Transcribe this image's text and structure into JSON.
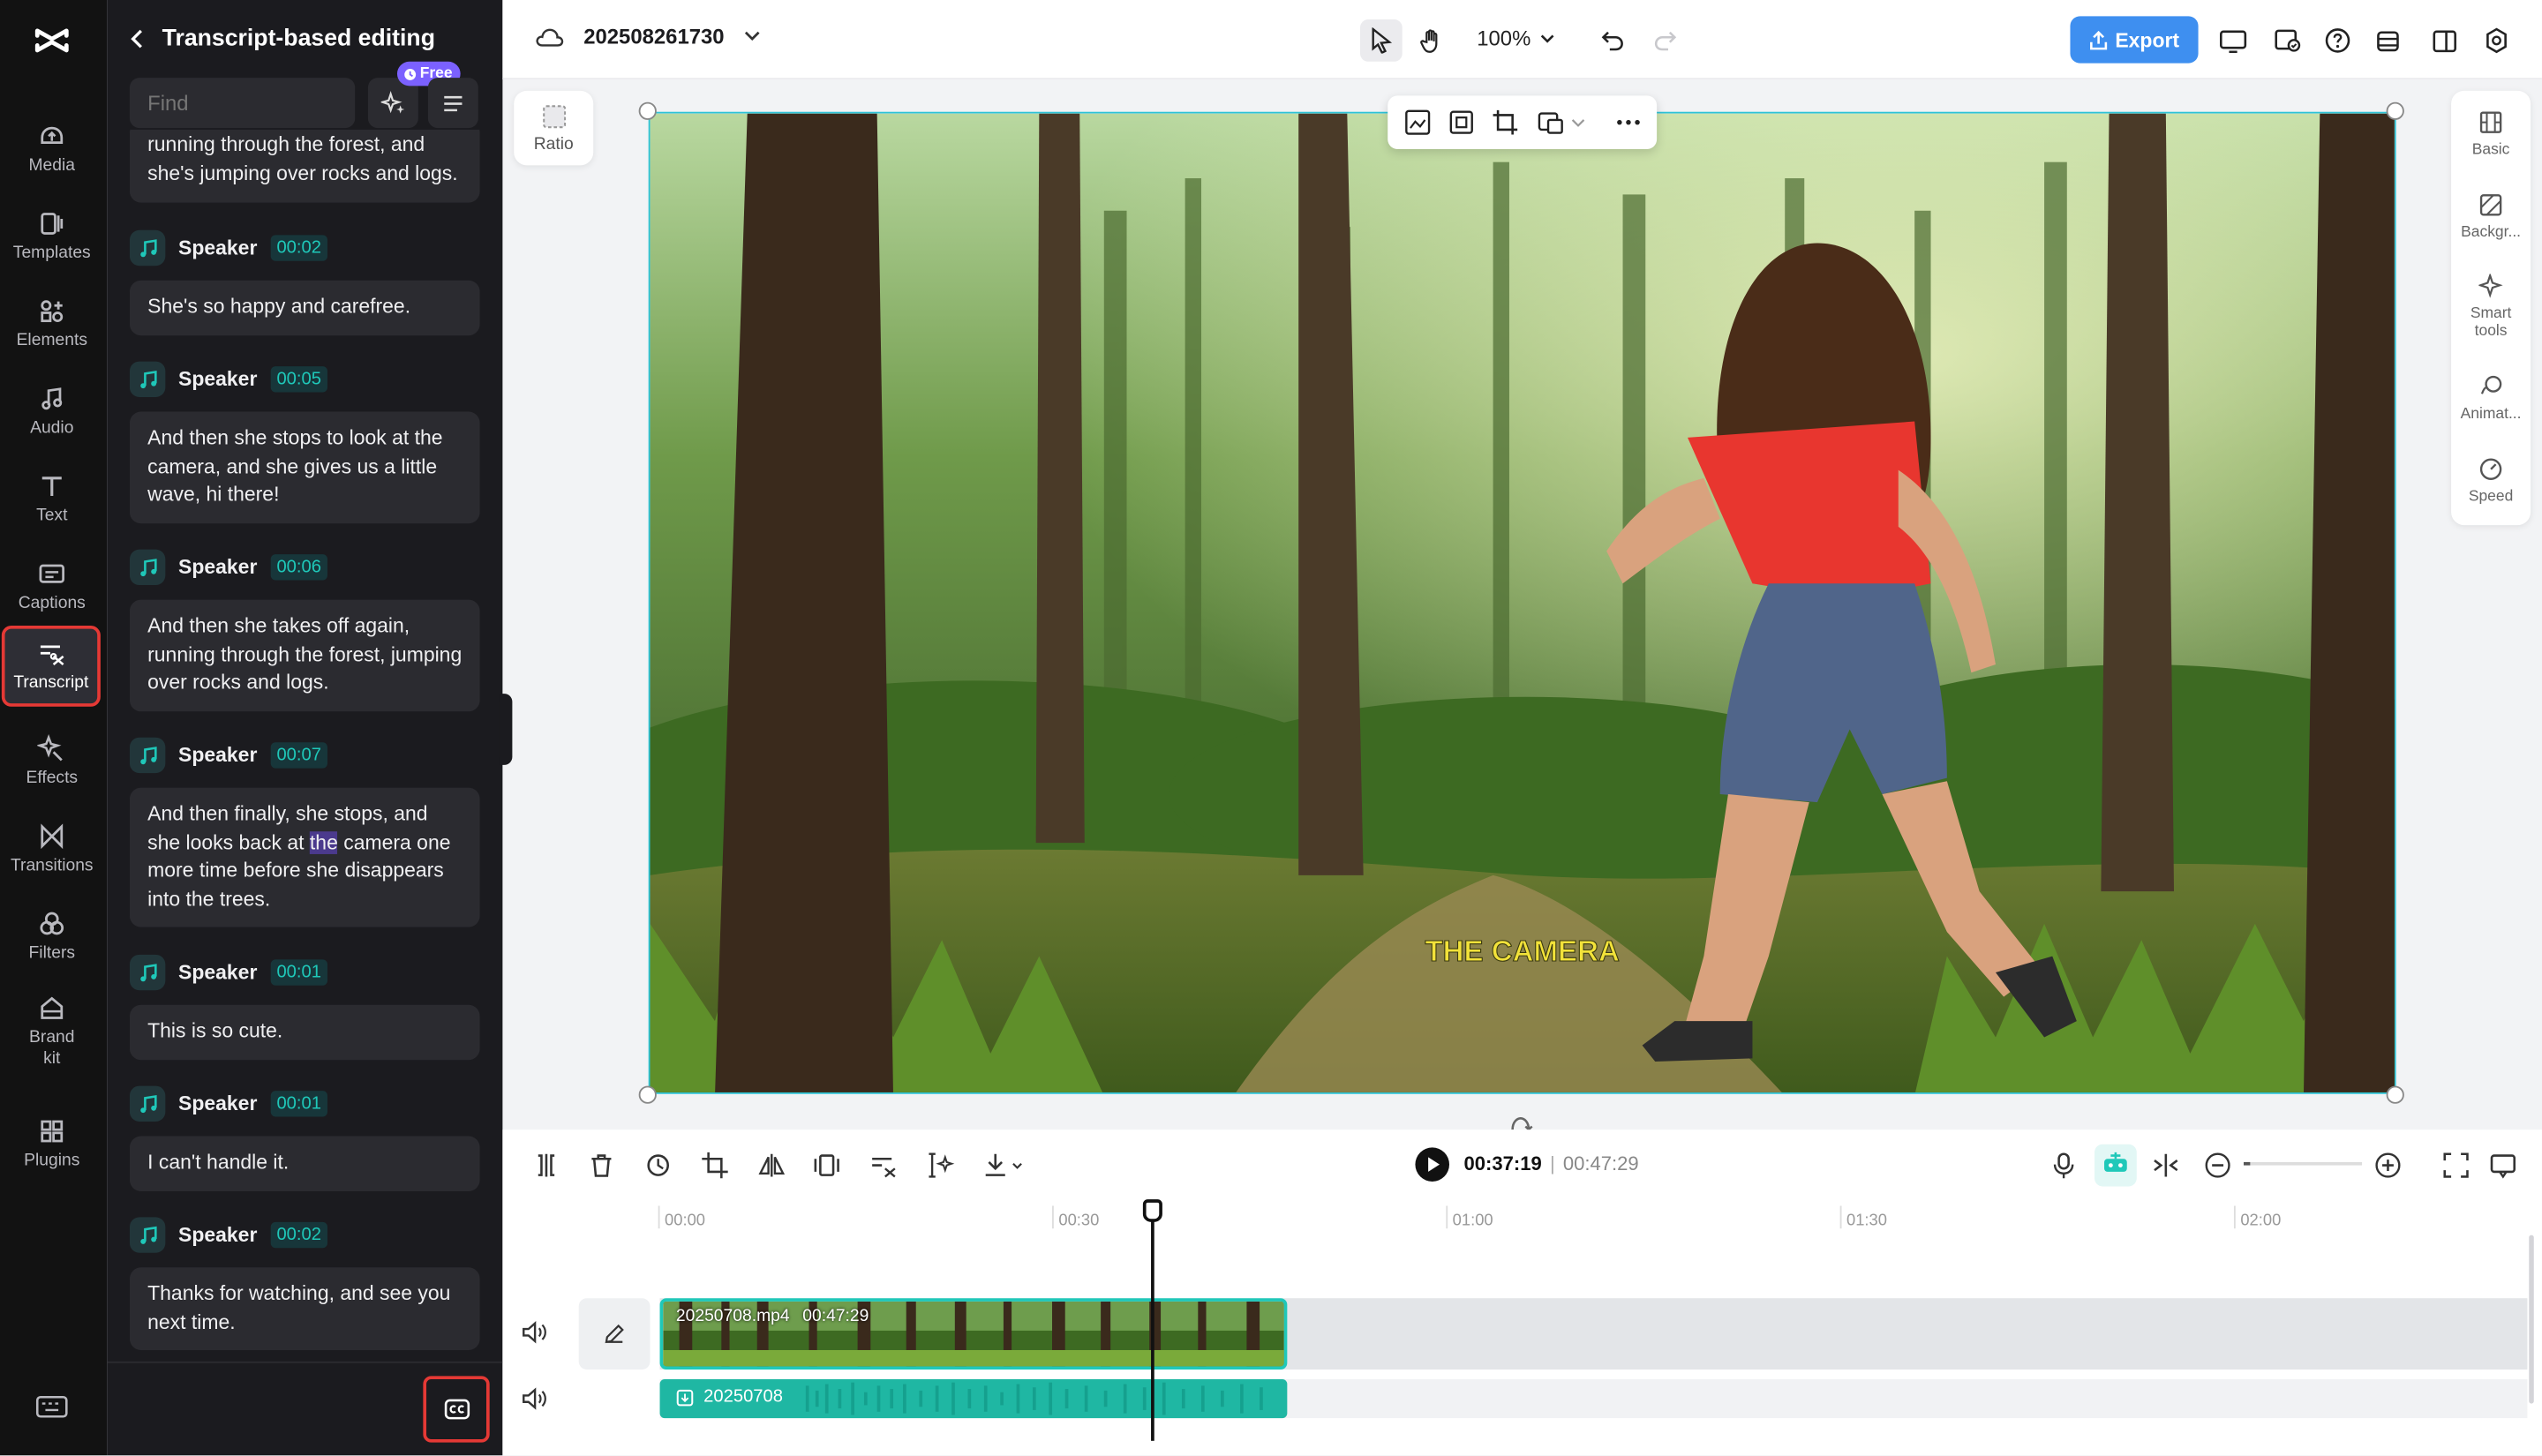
{
  "nav": {
    "items": [
      {
        "label": "Media",
        "icon": "media-icon"
      },
      {
        "label": "Templates",
        "icon": "templates-icon"
      },
      {
        "label": "Elements",
        "icon": "elements-icon"
      },
      {
        "label": "Audio",
        "icon": "audio-icon"
      },
      {
        "label": "Text",
        "icon": "text-icon"
      },
      {
        "label": "Captions",
        "icon": "captions-icon"
      },
      {
        "label": "Transcript",
        "icon": "transcript-icon",
        "active": true
      },
      {
        "label": "Effects",
        "icon": "effects-icon"
      },
      {
        "label": "Transitions",
        "icon": "transitions-icon"
      },
      {
        "label": "Filters",
        "icon": "filters-icon"
      },
      {
        "label": "Brand kit",
        "icon": "brand-kit-icon"
      },
      {
        "label": "Plugins",
        "icon": "plugins-icon"
      }
    ]
  },
  "panel": {
    "title": "Transcript-based editing",
    "find_placeholder": "Find",
    "free_badge": "Free",
    "segments": [
      {
        "speaker": "",
        "time": "",
        "text": "running through the forest, and she's jumping over rocks and logs."
      },
      {
        "speaker": "Speaker",
        "time": "00:02",
        "text": "She's so happy and carefree."
      },
      {
        "speaker": "Speaker",
        "time": "00:05",
        "text": "And then she stops to look at the camera, and she gives us a little wave, hi there!"
      },
      {
        "speaker": "Speaker",
        "time": "00:06",
        "text": "And then she takes off again, running through the forest, jumping over rocks and logs."
      },
      {
        "speaker": "Speaker",
        "time": "00:07",
        "text_before": "And then finally, she stops, and she looks back at ",
        "text_highlight": "the",
        "text_after": " camera one more time before she disappears into the trees."
      },
      {
        "speaker": "Speaker",
        "time": "00:01",
        "text": "This is so cute."
      },
      {
        "speaker": "Speaker",
        "time": "00:01",
        "text": "I can't handle it."
      },
      {
        "speaker": "Speaker",
        "time": "00:02",
        "text": "Thanks for watching, and see you next time."
      }
    ]
  },
  "topbar": {
    "project_name": "202508261730",
    "zoom": "100%",
    "export_label": "Export"
  },
  "canvas": {
    "ratio_label": "Ratio",
    "caption_text": "THE CAMERA"
  },
  "props": {
    "items": [
      {
        "label": "Basic",
        "icon": "basic-icon"
      },
      {
        "label": "Backgr...",
        "icon": "background-icon"
      },
      {
        "label": "Smart tools",
        "icon": "smart-tools-icon"
      },
      {
        "label": "Animat...",
        "icon": "animation-icon"
      },
      {
        "label": "Speed",
        "icon": "speed-icon"
      }
    ]
  },
  "timeline": {
    "current_time": "00:37:19",
    "duration": "00:47:29",
    "ruler": [
      "00:00",
      "00:30",
      "01:00",
      "01:30",
      "02:00"
    ],
    "video_clip": {
      "name": "20250708.mp4",
      "duration": "00:47:29"
    },
    "audio_clip": {
      "name": "20250708"
    },
    "accent_color": "#1fc8b9"
  }
}
